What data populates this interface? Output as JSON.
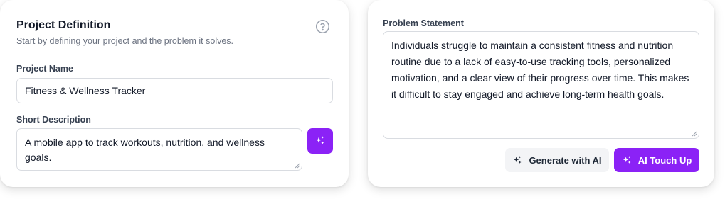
{
  "project": {
    "title": "Project Definition",
    "subtitle": "Start by defining your project and the problem it solves.",
    "help_icon": "question-circle-icon",
    "name_label": "Project Name",
    "name_value": "Fitness & Wellness Tracker",
    "desc_label": "Short Description",
    "desc_value": "A mobile app to track workouts, nutrition, and wellness goals.",
    "ai_icon": "sparkles-icon"
  },
  "problem": {
    "label": "Problem Statement",
    "value": "Individuals struggle to maintain a consistent fitness and nutrition routine due to a lack of easy-to-use tracking tools, personalized motivation, and a clear view of their progress over time. This makes it difficult to stay engaged and achieve long-term health goals.",
    "generate_label": "Generate with AI",
    "touchup_label": "AI Touch Up"
  },
  "colors": {
    "accent": "#8b22f6",
    "muted_text": "#6b7280",
    "secondary_button_bg": "#f3f4f6"
  }
}
